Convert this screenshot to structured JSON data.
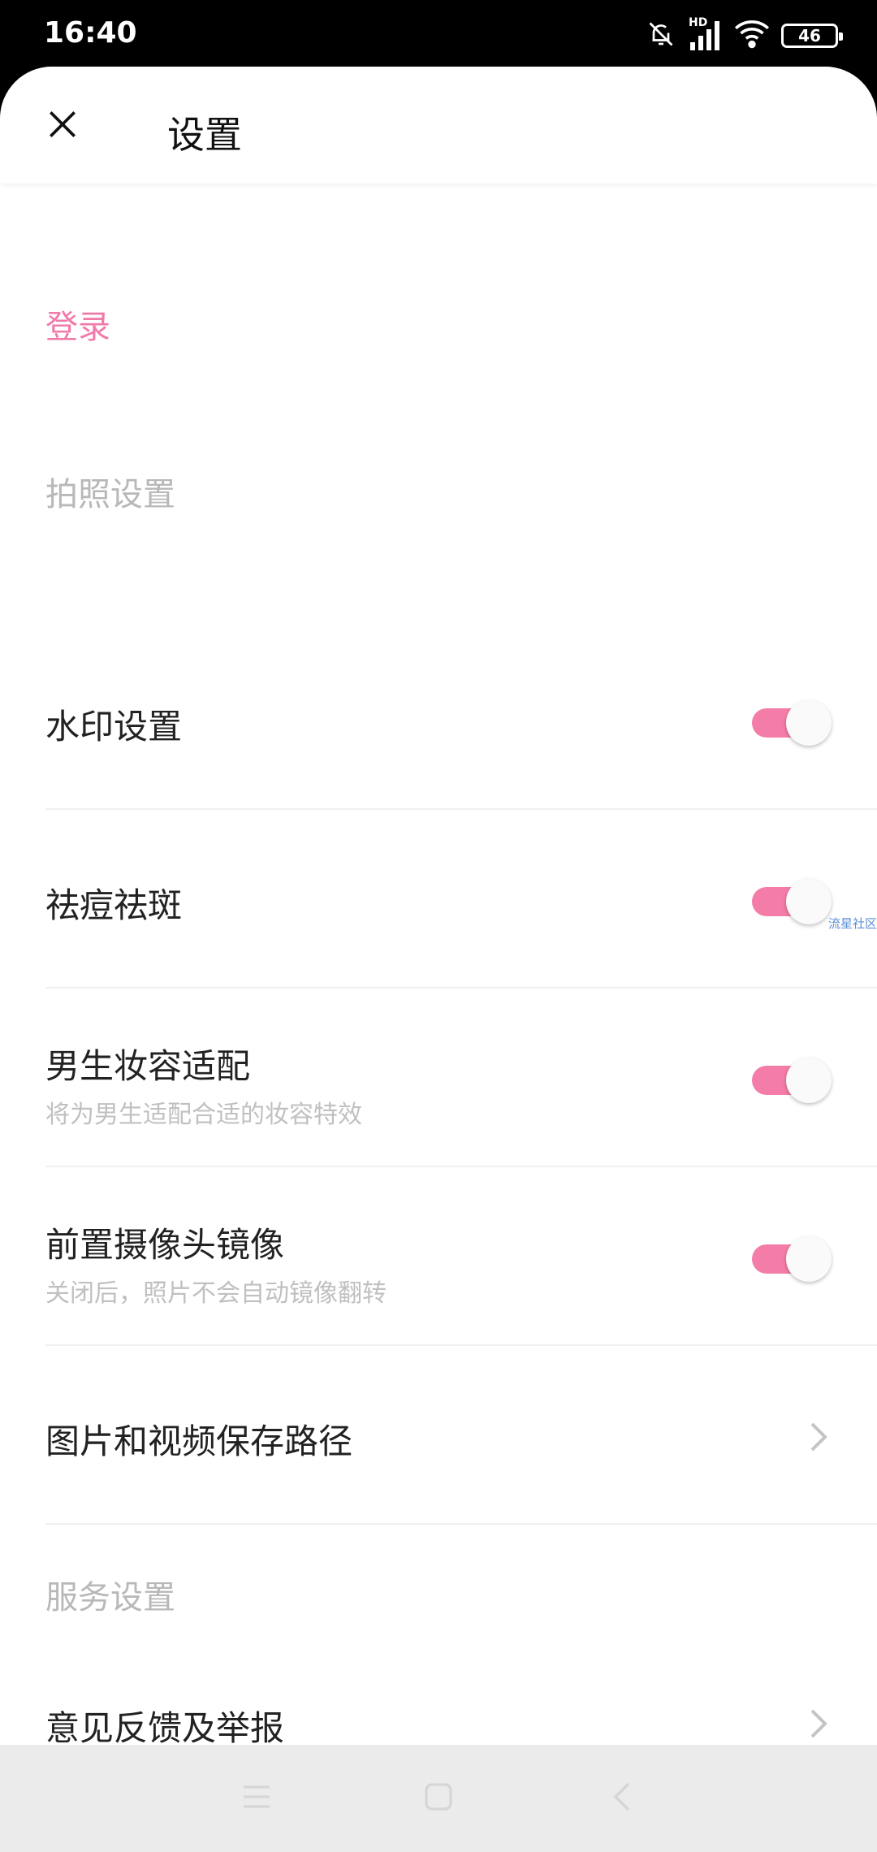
{
  "status_bar": {
    "time": "16:40",
    "network_label": "HD",
    "battery": "46",
    "icons": [
      "bell-off-icon",
      "signal-icon",
      "wifi-icon",
      "battery-icon"
    ]
  },
  "header": {
    "title": "设置"
  },
  "login": {
    "label": "登录"
  },
  "sections": {
    "camera": "拍照设置",
    "service": "服务设置"
  },
  "rows": {
    "watermark": {
      "title": "水印设置",
      "enabled": true
    },
    "acne_removal": {
      "title": "祛痘祛斑",
      "enabled": true
    },
    "male_makeup": {
      "title": "男生妆容适配",
      "subtitle": "将为男生适配合适的妆容特效",
      "enabled": true
    },
    "front_mirror": {
      "title": "前置摄像头镜像",
      "subtitle": "关闭后，照片不会自动镜像翻转",
      "enabled": true
    },
    "save_path": {
      "title": "图片和视频保存路径"
    },
    "feedback": {
      "title": "意见反馈及举报"
    }
  },
  "overlay": {
    "watermark_text": "流星社区"
  },
  "colors": {
    "accent": "#f07aaa",
    "toggle_on": "#f47ca8",
    "section_text": "#b8b8b8"
  }
}
